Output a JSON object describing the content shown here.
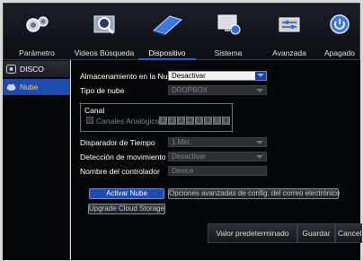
{
  "topnav": [
    {
      "label": "Parámetro",
      "icon": "gear-icon"
    },
    {
      "label": "Videos Búsqueda",
      "icon": "search-icon"
    },
    {
      "label": "Dispositivo",
      "icon": "hard-drive-icon"
    },
    {
      "label": "Sistema",
      "icon": "monitor-info-icon"
    },
    {
      "label": "Avanzada",
      "icon": "advanced-settings-icon"
    },
    {
      "label": "Apagado",
      "icon": "power-icon"
    }
  ],
  "sidebar": {
    "items": [
      {
        "label": "DISCO",
        "icon": "disk-icon"
      },
      {
        "label": "Nube",
        "icon": "cloud-icon"
      }
    ]
  },
  "form": {
    "storage_label": "Almacenamiento en la Nube",
    "storage_value": "Desactivar",
    "cloud_type_label": "Tipo de nube",
    "cloud_type_value": "DROPBOX",
    "channel_group_label": "Canal",
    "analog_channels_label": "Canales Analógicos",
    "channels": [
      "1",
      "2",
      "3",
      "4",
      "5",
      "6",
      "7",
      "8"
    ],
    "time_trigger_label": "Disparador de Tiempo",
    "time_trigger_value": "1 Min.",
    "motion_label": "Detección de movimiento",
    "motion_value": "Desactivar",
    "driver_name_label": "Nombre del controlador",
    "driver_name_value": "Device"
  },
  "actions": {
    "activate_label": "Activar Nube",
    "advanced_email_label": "Opciones avanzadas de config. del correo electrónico",
    "upgrade_label": "Upgrade Cloud Storage"
  },
  "footer": {
    "default_label": "Valor predeterminado",
    "save_label": "Guardar",
    "cancel_label": "Cancelar"
  },
  "colors": {
    "accent": "#1f4bb0",
    "active_text": "#ffd34a",
    "background": "#050608"
  }
}
